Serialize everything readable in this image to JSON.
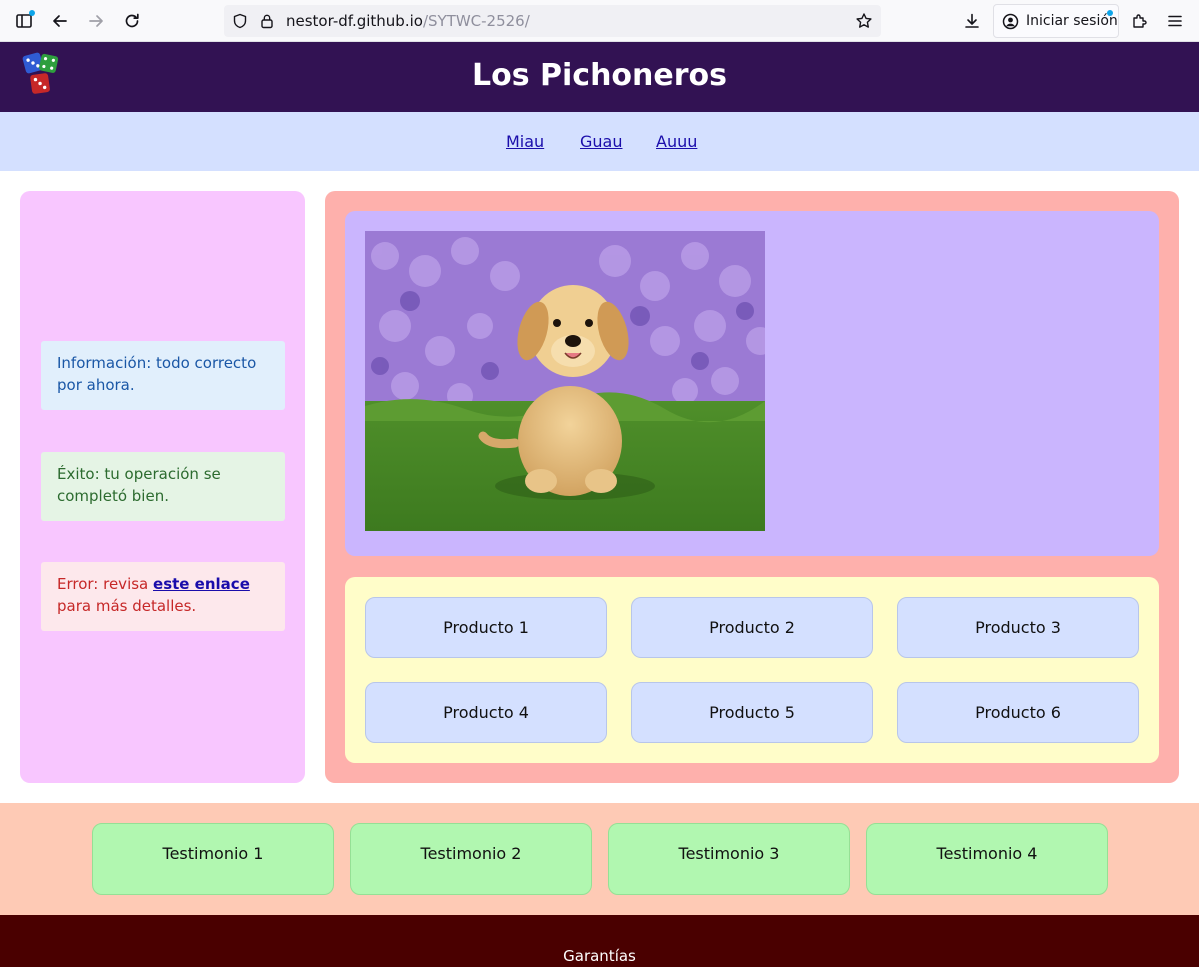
{
  "browser": {
    "url_host": "nestor-df.github.io",
    "url_path": "/SYTWC-2526/",
    "signin_label": "Iniciar sesión",
    "icons": [
      "sidebar-icon",
      "back-icon",
      "forward-icon",
      "reload-icon",
      "shield-icon",
      "lock-icon",
      "star-icon",
      "download-icon",
      "account-icon",
      "extensions-icon",
      "menu-icon"
    ]
  },
  "header": {
    "title": "Los Pichoneros",
    "logo_icon": "dice-icon"
  },
  "nav": {
    "links": [
      "Miau",
      "Guau",
      "Auuu"
    ]
  },
  "sidebar": {
    "info": "Información: todo correcto por ahora.",
    "success": "Éxito: tu operación se completó bien.",
    "error_prefix": "Error: revisa ",
    "error_link": "este enlace",
    "error_suffix": " para más detalles."
  },
  "main": {
    "hero_image": "puppy-in-flowers-photo",
    "products": [
      "Producto 1",
      "Producto 2",
      "Producto 3",
      "Producto 4",
      "Producto 5",
      "Producto 6"
    ]
  },
  "testimonials": [
    "Testimonio 1",
    "Testimonio 2",
    "Testimonio 3",
    "Testimonio 4"
  ],
  "footer": {
    "text": "Garantías"
  },
  "colors": {
    "header_bg": "#321253",
    "nav_bg": "#d4e0ff",
    "sidebar_bg": "#f8c6ff",
    "content_bg": "#feb0ac",
    "hero_bg": "#cab5fe",
    "products_bg": "#fffdc9",
    "product_card_bg": "#d4e0ff",
    "testimonials_bg": "#fecab5",
    "testimonial_card_bg": "#b1f7b0",
    "footer_bg": "#4a0000"
  }
}
